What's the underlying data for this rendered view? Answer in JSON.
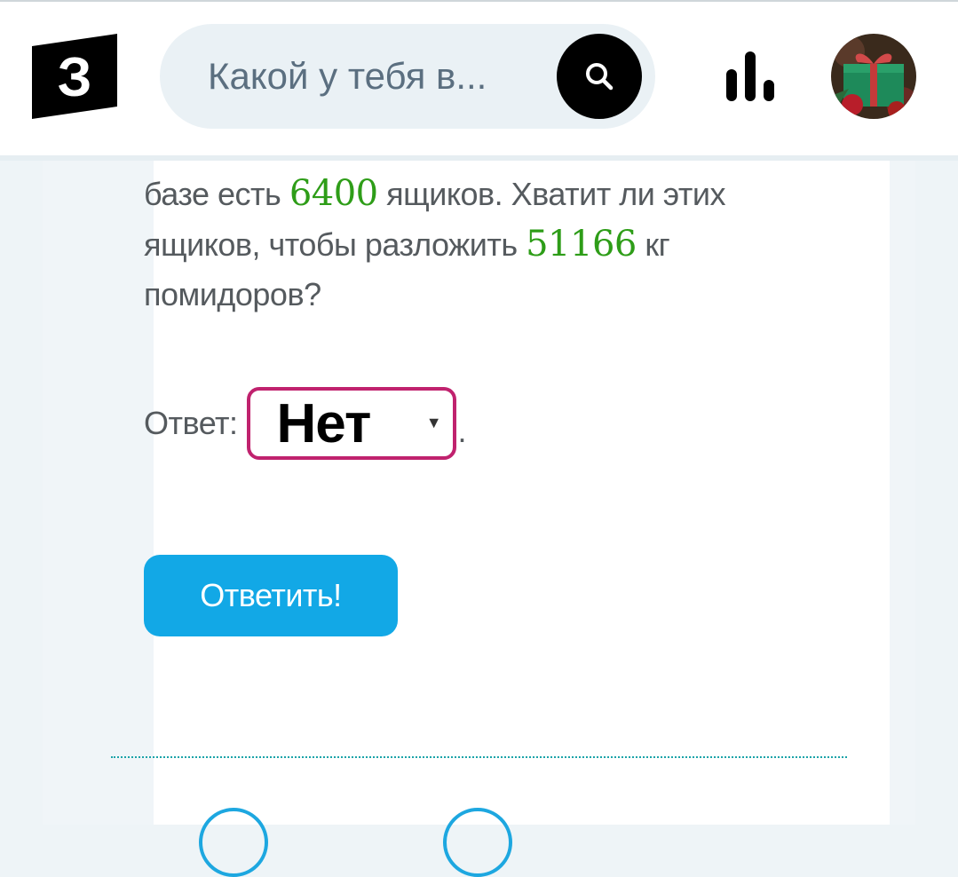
{
  "header": {
    "logo_letter": "З",
    "search_placeholder": "Какой у тебя в...",
    "search_icon": "search-icon",
    "stats_icon": "bar-chart-icon",
    "avatar_icon": "user-avatar"
  },
  "question": {
    "line1_prefix": "базе есть ",
    "boxes_count": "6400",
    "line1_suffix": " ящиков. Хватит ли этих",
    "line2_prefix": "ящиков, чтобы разложить ",
    "weight": "51166",
    "line2_suffix": " кг",
    "line3": "помидоров?"
  },
  "answer": {
    "label": "Ответ:",
    "selected_value": "Нет",
    "caret": "▼",
    "trailing": "."
  },
  "submit_label": "Ответить!",
  "colors": {
    "accent_green": "#2e9d18",
    "select_border": "#c0226e",
    "button_blue": "#12a8e6",
    "separator": "#1aa3a8"
  }
}
